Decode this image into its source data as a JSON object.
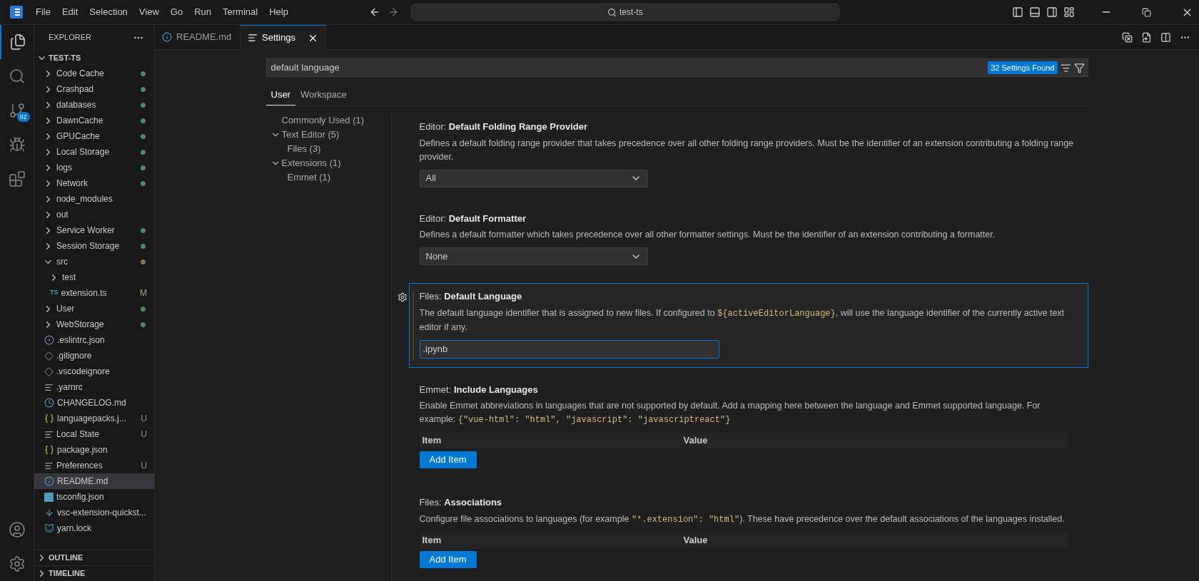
{
  "menu": [
    "File",
    "Edit",
    "Selection",
    "View",
    "Go",
    "Run",
    "Terminal",
    "Help"
  ],
  "command_center": {
    "value": "test-ts"
  },
  "activity_bar": [
    {
      "kind": "explorer",
      "selected": true
    },
    {
      "kind": "search",
      "selected": false
    },
    {
      "kind": "scm",
      "selected": false,
      "badge": "92"
    },
    {
      "kind": "debug",
      "selected": false
    },
    {
      "kind": "extensions",
      "selected": false
    }
  ],
  "explorer": {
    "title": "EXPLORER",
    "root": "TEST-TS",
    "items": [
      {
        "name": "Code Cache",
        "kind": "folder",
        "expanded": false,
        "selected": false,
        "color": "#4e8a5f"
      },
      {
        "name": "Crashpad",
        "kind": "folder",
        "expanded": false,
        "selected": false,
        "color": "#4e8a5f"
      },
      {
        "name": "databases",
        "kind": "folder",
        "expanded": false,
        "selected": false,
        "color": "#4e8a5f"
      },
      {
        "name": "DawnCache",
        "kind": "folder",
        "expanded": false,
        "selected": false,
        "color": "#4e8a5f"
      },
      {
        "name": "GPUCache",
        "kind": "folder",
        "expanded": false,
        "selected": false,
        "color": "#4e8a5f"
      },
      {
        "name": "Local Storage",
        "kind": "folder",
        "expanded": false,
        "selected": false,
        "color": "#4e8a5f"
      },
      {
        "name": "logs",
        "kind": "folder",
        "expanded": false,
        "selected": false,
        "color": "#4e8a5f"
      },
      {
        "name": "Network",
        "kind": "folder",
        "expanded": false,
        "selected": false,
        "color": "#4e8a5f"
      },
      {
        "name": "node_modules",
        "kind": "folder",
        "expanded": false,
        "selected": false
      },
      {
        "name": "out",
        "kind": "folder",
        "expanded": false,
        "selected": false
      },
      {
        "name": "Service Worker",
        "kind": "folder",
        "expanded": false,
        "selected": false,
        "color": "#4e8a5f"
      },
      {
        "name": "Session Storage",
        "kind": "folder",
        "expanded": false,
        "selected": false,
        "color": "#4e8a5f"
      },
      {
        "name": "src",
        "kind": "folder",
        "expanded": true,
        "selected": false,
        "color": "#8a7454",
        "children": [
          {
            "name": "test",
            "kind": "folder",
            "expanded": false,
            "selected": false
          },
          {
            "name": "extension.ts",
            "kind": "ts",
            "icon_text": "TS",
            "selected": false,
            "badge": {
              "text": "M",
              "color": "#b0a27a"
            }
          }
        ]
      },
      {
        "name": "User",
        "kind": "folder",
        "expanded": false,
        "selected": false,
        "color": "#4e8a5f"
      },
      {
        "name": "WebStorage",
        "kind": "folder",
        "expanded": false,
        "selected": false,
        "color": "#4e8a5f"
      },
      {
        "name": ".eslintrc.json",
        "kind": "eslint",
        "selected": false
      },
      {
        "name": ".gitignore",
        "kind": "git",
        "selected": false
      },
      {
        "name": ".vscodeignore",
        "kind": "git",
        "selected": false
      },
      {
        "name": ".yarnrc",
        "kind": "text",
        "selected": false
      },
      {
        "name": "CHANGELOG.md",
        "kind": "changelog",
        "selected": false
      },
      {
        "name": "languagepacks.j...",
        "kind": "json",
        "selected": false,
        "badge": {
          "text": "U",
          "color": "#73a98a"
        }
      },
      {
        "name": "Local State",
        "kind": "text",
        "selected": false,
        "badge": {
          "text": "U",
          "color": "#73a98a"
        }
      },
      {
        "name": "package.json",
        "kind": "json",
        "selected": false
      },
      {
        "name": "Preferences",
        "kind": "text",
        "selected": false,
        "badge": {
          "text": "U",
          "color": "#73a98a"
        }
      },
      {
        "name": "README.md",
        "kind": "info",
        "selected": true
      },
      {
        "name": "tsconfig.json",
        "kind": "tsconfig",
        "selected": false
      },
      {
        "name": "vsc-extension-quickst...",
        "kind": "download",
        "selected": false
      },
      {
        "name": "yarn.lock",
        "kind": "yarn",
        "selected": false
      }
    ],
    "sections": [
      {
        "label": "OUTLINE",
        "expanded": false
      },
      {
        "label": "TIMELINE",
        "expanded": false
      }
    ]
  },
  "tabs": [
    {
      "label": "README.md",
      "kind": "info",
      "selected": false
    },
    {
      "label": "Settings",
      "kind": "settings",
      "selected": true
    }
  ],
  "settings": {
    "search": {
      "value": "default language"
    },
    "found": "32 Settings Found",
    "scopes": [
      {
        "label": "User",
        "selected": true
      },
      {
        "label": "Workspace",
        "selected": false
      }
    ],
    "toc": [
      {
        "label": "Commonly Used (1)"
      },
      {
        "label": "Text Editor (5)",
        "expanded": true,
        "children": [
          {
            "label": "Files (3)"
          }
        ]
      },
      {
        "label": "Extensions (1)",
        "expanded": true,
        "children": [
          {
            "label": "Emmet (1)"
          }
        ]
      }
    ],
    "items": [
      {
        "category": "Editor:",
        "title": "Default Folding Range Provider",
        "kind": "dropdown",
        "focused": false,
        "description": [
          {
            "kind": "text",
            "text": "Defines a default folding range provider that takes precedence over all other folding range providers. Must be the identifier of an extension contributing a folding range provider."
          }
        ],
        "value": "All"
      },
      {
        "category": "Editor:",
        "title": "Default Formatter",
        "kind": "dropdown",
        "focused": false,
        "description": [
          {
            "kind": "text",
            "text": "Defines a default formatter which takes precedence over all other formatter settings. Must be the identifier of an extension contributing a formatter."
          }
        ],
        "value": "None"
      },
      {
        "category": "Files:",
        "title": "Default Language",
        "kind": "text",
        "focused": true,
        "description": [
          {
            "kind": "text",
            "text": "The default language identifier that is assigned to new files. If configured to "
          },
          {
            "kind": "code",
            "text": "${activeEditorLanguage}"
          },
          {
            "kind": "text",
            "text": ", will use the language identifier of the currently active text editor if any."
          }
        ],
        "value": ".ipynb"
      },
      {
        "category": "Emmet:",
        "title": "Include Languages",
        "kind": "list",
        "focused": false,
        "description": [
          {
            "kind": "text",
            "text": "Enable Emmet abbreviations in languages that are not supported by default. Add a mapping here between the language and Emmet supported language. For example: "
          },
          {
            "kind": "code",
            "text": "{\"vue-html\": \"html\", \"javascript\": \"javascriptreact\"}"
          }
        ],
        "columns": [
          "Item",
          "Value"
        ],
        "button": "Add Item"
      },
      {
        "category": "Files:",
        "title": "Associations",
        "kind": "list",
        "focused": false,
        "description": [
          {
            "kind": "text",
            "text": "Configure file associations to languages (for example "
          },
          {
            "kind": "code",
            "text": "\"*.extension\": \"html\""
          },
          {
            "kind": "text",
            "text": "). These have precedence over the default associations of the languages installed."
          }
        ],
        "columns": [
          "Item",
          "Value"
        ],
        "button": "Add Item"
      }
    ]
  }
}
